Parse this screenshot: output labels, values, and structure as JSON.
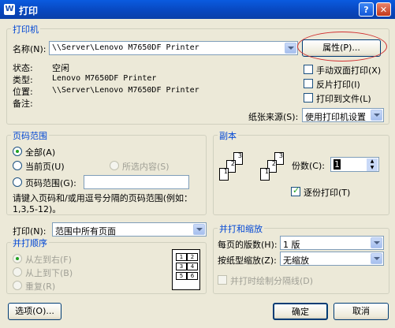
{
  "window": {
    "title": "打印",
    "icon": "W"
  },
  "printer": {
    "legend": "打印机",
    "name_label": "名称(N):",
    "name_value": "\\\\Server\\Lenovo M7650DF Printer",
    "properties_button": "属性(P)...",
    "status_label": "状态:",
    "status_value": "空闲",
    "type_label": "类型:",
    "type_value": "Lenovo M7650DF Printer",
    "where_label": "位置:",
    "where_value": "\\\\Server\\Lenovo M7650DF Printer",
    "comment_label": "备注:",
    "manual_duplex": "手动双面打印(X)",
    "reverse_print": "反片打印(I)",
    "print_to_file": "打印到文件(L)",
    "paper_source_label": "纸张来源(S):",
    "paper_source_value": "使用打印机设置"
  },
  "page_range": {
    "legend": "页码范围",
    "all": "全部(A)",
    "current": "当前页(U)",
    "selection": "所选内容(S)",
    "pages": "页码范围(G):",
    "hint_line1": "请键入页码和/或用逗号分隔的页码范围(例如：",
    "hint_line2": "1,3,5-12)。"
  },
  "copies": {
    "legend": "副本",
    "count_label": "份数(C):",
    "count_value": "1",
    "collate": "逐份打印(T)"
  },
  "print_what": {
    "label": "打印(N):",
    "value": "范围中所有页面"
  },
  "order": {
    "legend": "并打顺序",
    "left_to_right": "从左到右(F)",
    "top_to_bottom": "从上到下(B)",
    "repeat": "重复(R)"
  },
  "zoom": {
    "legend": "并打和缩放",
    "pages_per_sheet_label": "每页的版数(H):",
    "pages_per_sheet_value": "1 版",
    "scale_label": "按纸型缩放(Z):",
    "scale_value": "无缩放",
    "draw_borders": "并打时绘制分隔线(D)"
  },
  "footer": {
    "options": "选项(O)...",
    "ok": "确定",
    "cancel": "取消"
  }
}
